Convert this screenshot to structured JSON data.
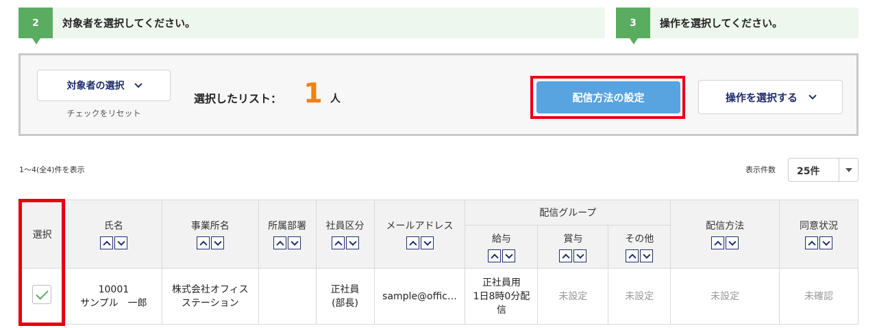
{
  "steps": [
    {
      "num": "2",
      "text": "対象者を選択してください。"
    },
    {
      "num": "3",
      "text": "操作を選択してください。"
    }
  ],
  "panel": {
    "target_select_label": "対象者の選択",
    "reset_label": "チェックをリセット",
    "selected_label": "選択したリスト：",
    "selected_count": "1",
    "selected_unit": "人",
    "delivery_button": "配信方法の設定",
    "operation_select": "操作を選択する"
  },
  "result_info": "1〜4(全4)件を表示",
  "per_page": {
    "label": "表示件数",
    "value": "25件"
  },
  "table": {
    "headers": {
      "select": "選択",
      "name": "氏名",
      "office": "事業所名",
      "dept": "所属部署",
      "emp_type": "社員区分",
      "email": "メールアドレス",
      "group": "配信グループ",
      "salary": "給与",
      "bonus": "賞与",
      "other": "その他",
      "method": "配信方法",
      "consent": "同意状況"
    },
    "rows": [
      {
        "id": "10001",
        "name": "サンプル　一郎",
        "office_l1": "株式会社オフィス",
        "office_l2": "ステーション",
        "dept": "",
        "emp_type_l1": "正社員",
        "emp_type_l2": "(部長)",
        "email": "sample@offic…",
        "salary_l1": "正社員用",
        "salary_l2": "1日8時0分配",
        "salary_l3": "信",
        "bonus": "未設定",
        "other": "未設定",
        "method": "未設定",
        "consent": "未確認"
      }
    ]
  },
  "colors": {
    "accent_green": "#5aac60",
    "highlight_red": "#e60012",
    "button_blue": "#58a4e0",
    "count_orange": "#f0820a"
  }
}
